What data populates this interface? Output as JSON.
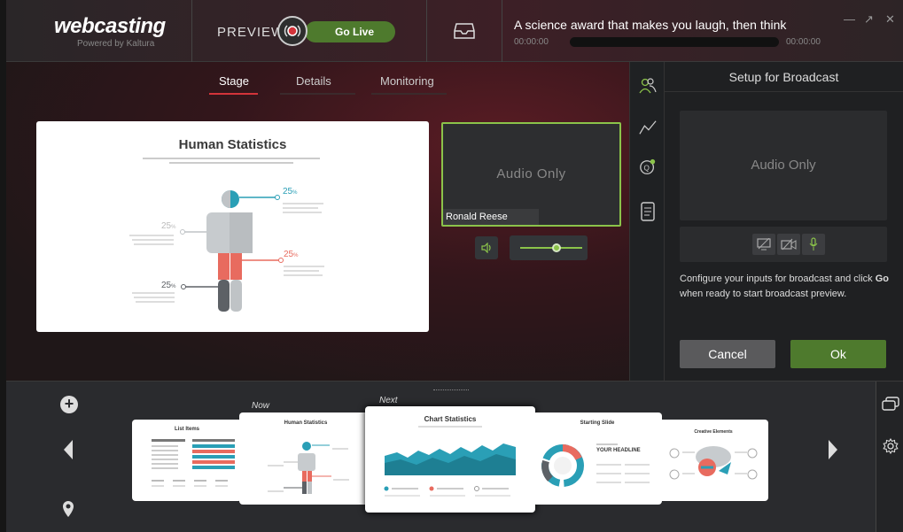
{
  "app": {
    "logo_text": "webcasting",
    "logo_sub": "Powered by Kaltura"
  },
  "preview": {
    "label": "PREVIEW",
    "go_live": "Go Live"
  },
  "event": {
    "title": "A science award that makes you laugh, then think",
    "time_start": "00:00:00",
    "time_end": "00:00:00",
    "progress": 0
  },
  "tabs": [
    {
      "label": "Stage",
      "active": true
    },
    {
      "label": "Details",
      "active": false
    },
    {
      "label": "Monitoring",
      "active": false
    }
  ],
  "stage_slide": {
    "title": "Human Statistics",
    "stat_value": "25",
    "stat_unit": "%"
  },
  "camera": {
    "placeholder": "Audio Only",
    "presenter": "Ronald Reese",
    "volume": 0.6
  },
  "setup": {
    "title": "Setup for Broadcast",
    "preview_placeholder": "Audio Only",
    "desc_part1": "Configure your inputs for broadcast and click ",
    "desc_bold": "Go",
    "desc_part2": " when ready to start broadcast preview.",
    "cancel": "Cancel",
    "ok": "Ok"
  },
  "playlist": {
    "now_label": "Now",
    "next_label": "Next",
    "slides": [
      {
        "title": "List Items"
      },
      {
        "title": "Human Statistics"
      },
      {
        "title": "Chart Statistics"
      },
      {
        "title": "Starting Slide",
        "headline": "YOUR HEADLINE"
      },
      {
        "title": "Creative Elements"
      }
    ]
  },
  "colors": {
    "accent_green": "#4e7a2d",
    "live_red": "#d3343a",
    "tab_active_line": "#d3343a"
  }
}
